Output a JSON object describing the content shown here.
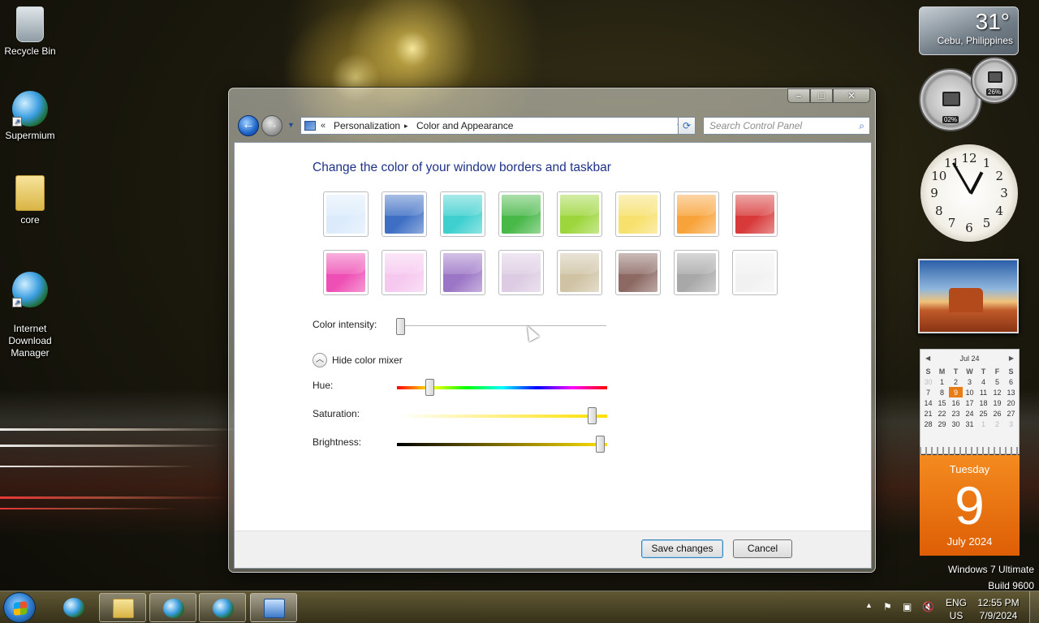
{
  "desktop": {
    "icons": [
      {
        "label": "Recycle Bin",
        "icon": "recycle-bin-icon"
      },
      {
        "label": "Supermium",
        "icon": "supermium-browser-icon"
      },
      {
        "label": "core",
        "icon": "folder-icon"
      },
      {
        "label": "Internet\nDownload\nManager",
        "icon": "idm-icon"
      }
    ]
  },
  "window": {
    "controls": {
      "minimize": "–",
      "maximize": "□",
      "close": "✕"
    },
    "nav": {
      "back": "←",
      "forward": "→"
    },
    "address": {
      "chevron": "«",
      "crumbs": [
        "Personalization",
        "Color and Appearance"
      ],
      "separator": "▸"
    },
    "search_placeholder": "Search Control Panel",
    "heading": "Change the color of your window borders and taskbar",
    "swatches": [
      {
        "name": "Sky",
        "color": "#dcebfb"
      },
      {
        "name": "Twilight",
        "color": "#3e6fc4"
      },
      {
        "name": "Sea",
        "color": "#3fcfcf"
      },
      {
        "name": "Leaf",
        "color": "#48b848"
      },
      {
        "name": "Lime",
        "color": "#9dd63c"
      },
      {
        "name": "Frost",
        "color": "#f7e06b"
      },
      {
        "name": "Pumpkin",
        "color": "#f8a33a"
      },
      {
        "name": "Ruby",
        "color": "#d83a3a"
      },
      {
        "name": "Fuchsia",
        "color": "#ee4fb4"
      },
      {
        "name": "Blush",
        "color": "#f6c8ef"
      },
      {
        "name": "Violet",
        "color": "#9c76c6"
      },
      {
        "name": "Lavender",
        "color": "#dccbe2"
      },
      {
        "name": "Taupe",
        "color": "#cfc3a4"
      },
      {
        "name": "Chocolate",
        "color": "#8c6963"
      },
      {
        "name": "Slate",
        "color": "#a8a8a8"
      },
      {
        "name": "Frost White",
        "color": "#f1f1f1"
      }
    ],
    "color_intensity_label": "Color intensity:",
    "color_intensity_value": 0.02,
    "mixer_toggle_label": "Hide color mixer",
    "hue_label": "Hue:",
    "hue_value": 0.16,
    "saturation_label": "Saturation:",
    "saturation_value": 0.93,
    "brightness_label": "Brightness:",
    "brightness_value": 0.97,
    "save_label": "Save changes",
    "cancel_label": "Cancel"
  },
  "gadgets": {
    "weather": {
      "temp": "31°",
      "city": "Cebu, Philippines"
    },
    "cpu_meter": {
      "cpu": "02%",
      "ram": "26%"
    },
    "clock": {
      "numbers": [
        "12",
        "1",
        "2",
        "3",
        "4",
        "5",
        "6",
        "7",
        "8",
        "9",
        "10",
        "11"
      ],
      "hour": 12,
      "minute": 55
    },
    "calendar": {
      "month_label": "Jul 24",
      "day_headers": [
        "S",
        "M",
        "T",
        "W",
        "T",
        "F",
        "S"
      ],
      "weeks": [
        [
          "30",
          "1",
          "2",
          "3",
          "4",
          "5",
          "6"
        ],
        [
          "7",
          "8",
          "9",
          "10",
          "11",
          "12",
          "13"
        ],
        [
          "14",
          "15",
          "16",
          "17",
          "18",
          "19",
          "20"
        ],
        [
          "21",
          "22",
          "23",
          "24",
          "25",
          "26",
          "27"
        ],
        [
          "28",
          "29",
          "30",
          "31",
          "1",
          "2",
          "3"
        ]
      ],
      "today": "9",
      "weekday": "Tuesday",
      "month_year": "July 2024"
    }
  },
  "os_watermark": {
    "line1": "Windows 7 Ultimate",
    "line2": "Build 9600"
  },
  "taskbar": {
    "items": [
      {
        "name": "supermium",
        "icon": "supermium-browser-icon",
        "state": "pinned"
      },
      {
        "name": "explorer",
        "icon": "folder-icon",
        "state": "open"
      },
      {
        "name": "supermium-running",
        "icon": "supermium-browser-icon",
        "state": "open"
      },
      {
        "name": "idm",
        "icon": "idm-icon",
        "state": "open"
      },
      {
        "name": "control-panel",
        "icon": "control-panel-icon",
        "state": "active"
      }
    ],
    "tray": {
      "lang": "ENG",
      "region": "US",
      "time": "12:55 PM",
      "date": "7/9/2024"
    }
  }
}
